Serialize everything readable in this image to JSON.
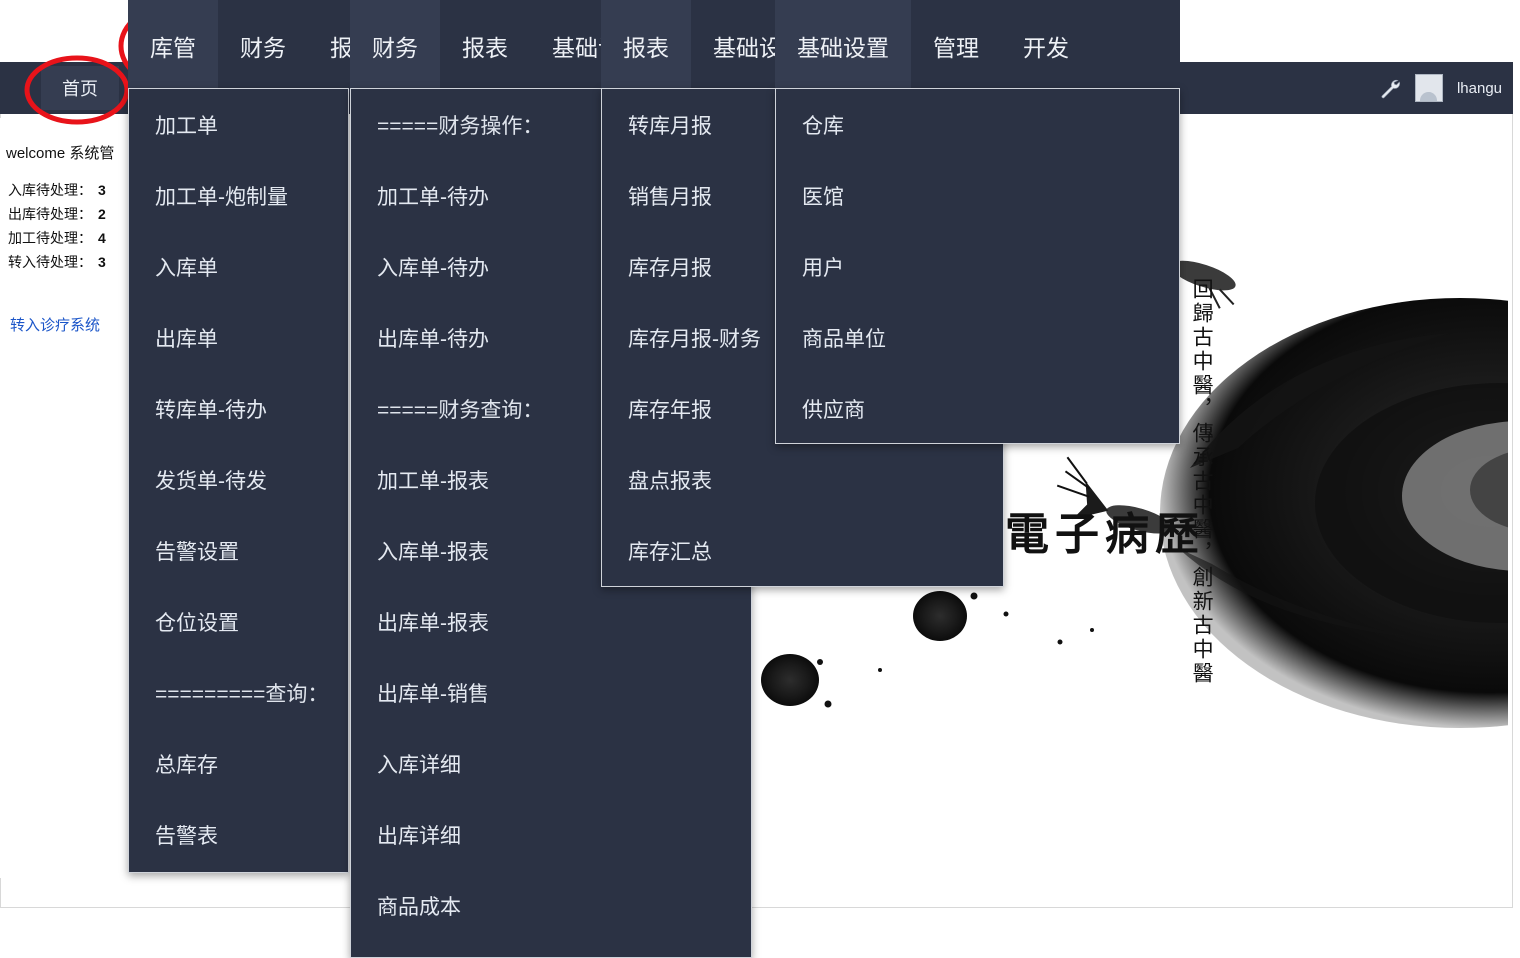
{
  "app": {
    "home_tab": "首页",
    "username": "lhangu",
    "wrench_icon": "wrench-icon",
    "avatar_icon": "user-avatar-icon"
  },
  "left_panel": {
    "welcome": "welcome 系统管",
    "stats": [
      {
        "label": "入库待处理：",
        "value": "3"
      },
      {
        "label": "出库待处理：",
        "value": "2"
      },
      {
        "label": "加工待处理：",
        "value": "4"
      },
      {
        "label": "转入待处理：",
        "value": "3"
      }
    ],
    "clinic_link": "转入诊疗系统"
  },
  "artwork": {
    "title_text": "電子病歷",
    "vertical_calligraphy": "回歸古中醫，傳承古中醫，創新古中醫"
  },
  "menubars": [
    {
      "name": "menubar-kuguan",
      "items": [
        {
          "label": "库管",
          "active": true
        },
        {
          "label": "财务",
          "active": false
        },
        {
          "label": "报表",
          "active": false
        },
        {
          "label": "基础设置",
          "active": false
        },
        {
          "label": "管理",
          "active": false
        },
        {
          "label": "开发",
          "active": false
        }
      ]
    },
    {
      "name": "menubar-caiwu",
      "items": [
        {
          "label": "财务",
          "active": true
        },
        {
          "label": "报表",
          "active": false
        },
        {
          "label": "基础设置",
          "active": false
        },
        {
          "label": "管理",
          "active": false
        },
        {
          "label": "开发",
          "active": false
        }
      ]
    },
    {
      "name": "menubar-baobiao",
      "items": [
        {
          "label": "报表",
          "active": true
        },
        {
          "label": "基础设置",
          "active": false
        },
        {
          "label": "管理",
          "active": false
        },
        {
          "label": "开发",
          "active": false
        }
      ]
    },
    {
      "name": "menubar-jichu",
      "items": [
        {
          "label": "基础设置",
          "active": true
        },
        {
          "label": "管理",
          "active": false
        },
        {
          "label": "开发",
          "active": false
        }
      ]
    }
  ],
  "dropdowns": {
    "kuguan": {
      "title": "库管",
      "items": [
        "加工单",
        "加工单-炮制量",
        "入库单",
        "出库单",
        "转库单-待办",
        "发货单-待发",
        "告警设置",
        "仓位设置",
        "=========查询：",
        "总库存",
        "告警表"
      ]
    },
    "caiwu": {
      "title": "财务",
      "items": [
        "=====财务操作：",
        "加工单-待办",
        "入库单-待办",
        "出库单-待办",
        "=====财务查询：",
        "加工单-报表",
        "入库单-报表",
        "出库单-报表",
        "出库单-销售",
        "入库详细",
        "出库详细",
        "商品成本"
      ]
    },
    "baobiao": {
      "title": "报表",
      "items": [
        "转库月报",
        "销售月报",
        "库存月报",
        "库存月报-财务",
        "库存年报",
        "盘点报表",
        "库存汇总"
      ]
    },
    "jichu": {
      "title": "基础设置",
      "items": [
        "仓库",
        "医馆",
        "用户",
        "商品单位",
        "供应商"
      ]
    }
  },
  "annotations": {
    "color": "#e8131a",
    "highlighted": [
      "库管",
      "财务",
      "报表",
      "基础设置",
      "首页"
    ]
  },
  "colors": {
    "menu_bg": "#2b3244",
    "menu_active": "#353d51",
    "menu_text": "#eef1f6",
    "link": "#1b55c8",
    "annotation_red": "#e8131a",
    "page_bg": "#ffffff"
  }
}
